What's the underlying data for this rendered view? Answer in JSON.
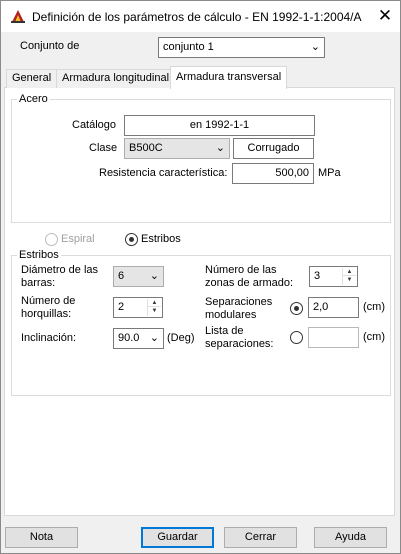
{
  "window": {
    "title": "Definición de los parámetros de cálculo - EN 1992-1-1:2004/A...",
    "close_glyph": "✕"
  },
  "header": {
    "conjunto_label": "Conjunto de",
    "conjunto_value": "conjunto 1"
  },
  "tabs": [
    {
      "label": "General"
    },
    {
      "label": "Armadura longitudinal"
    },
    {
      "label": "Armadura transversal"
    }
  ],
  "acero": {
    "legend": "Acero",
    "catalogo_label": "Catálogo",
    "catalogo_value": "en 1992-1-1",
    "clase_label": "Clase",
    "clase_value": "B500C",
    "clase_type": "Corrugado",
    "resistencia_label": "Resistencia característica:",
    "resistencia_value": "500,00",
    "resistencia_unit": "MPa"
  },
  "type_choice": {
    "espiral_label": "Espiral",
    "estribos_label": "Estribos"
  },
  "estribos": {
    "legend": "Estribos",
    "diametro_label_1": "Diámetro de las",
    "diametro_label_2": "barras:",
    "diametro_value": "6",
    "horquillas_label_1": "Número de",
    "horquillas_label_2": "horquillas:",
    "horquillas_value": "2",
    "inclinacion_label": "Inclinación:",
    "inclinacion_value": "90.0",
    "inclinacion_unit": "(Deg)",
    "zonas_label_1": "Número de las",
    "zonas_label_2": "zonas de armado:",
    "zonas_value": "3",
    "separaciones_label_1": "Separaciones",
    "separaciones_label_2": "modulares",
    "separaciones_value": "2,0",
    "separaciones_unit": "(cm)",
    "lista_label_1": "Lista de",
    "lista_label_2": "separaciones:",
    "lista_value": "",
    "lista_unit": "(cm)"
  },
  "footer": {
    "nota": "Nota",
    "guardar": "Guardar",
    "cerrar": "Cerrar",
    "ayuda": "Ayuda"
  },
  "icons": {
    "app": "app-logo-icon",
    "dropdown": "chevron-down-icon",
    "spin": "spin-arrows-icon"
  },
  "colors": {
    "accent_border": "#0078d7",
    "dialog_bg": "#f0f0f0",
    "panel_bg": "#ffffff"
  }
}
